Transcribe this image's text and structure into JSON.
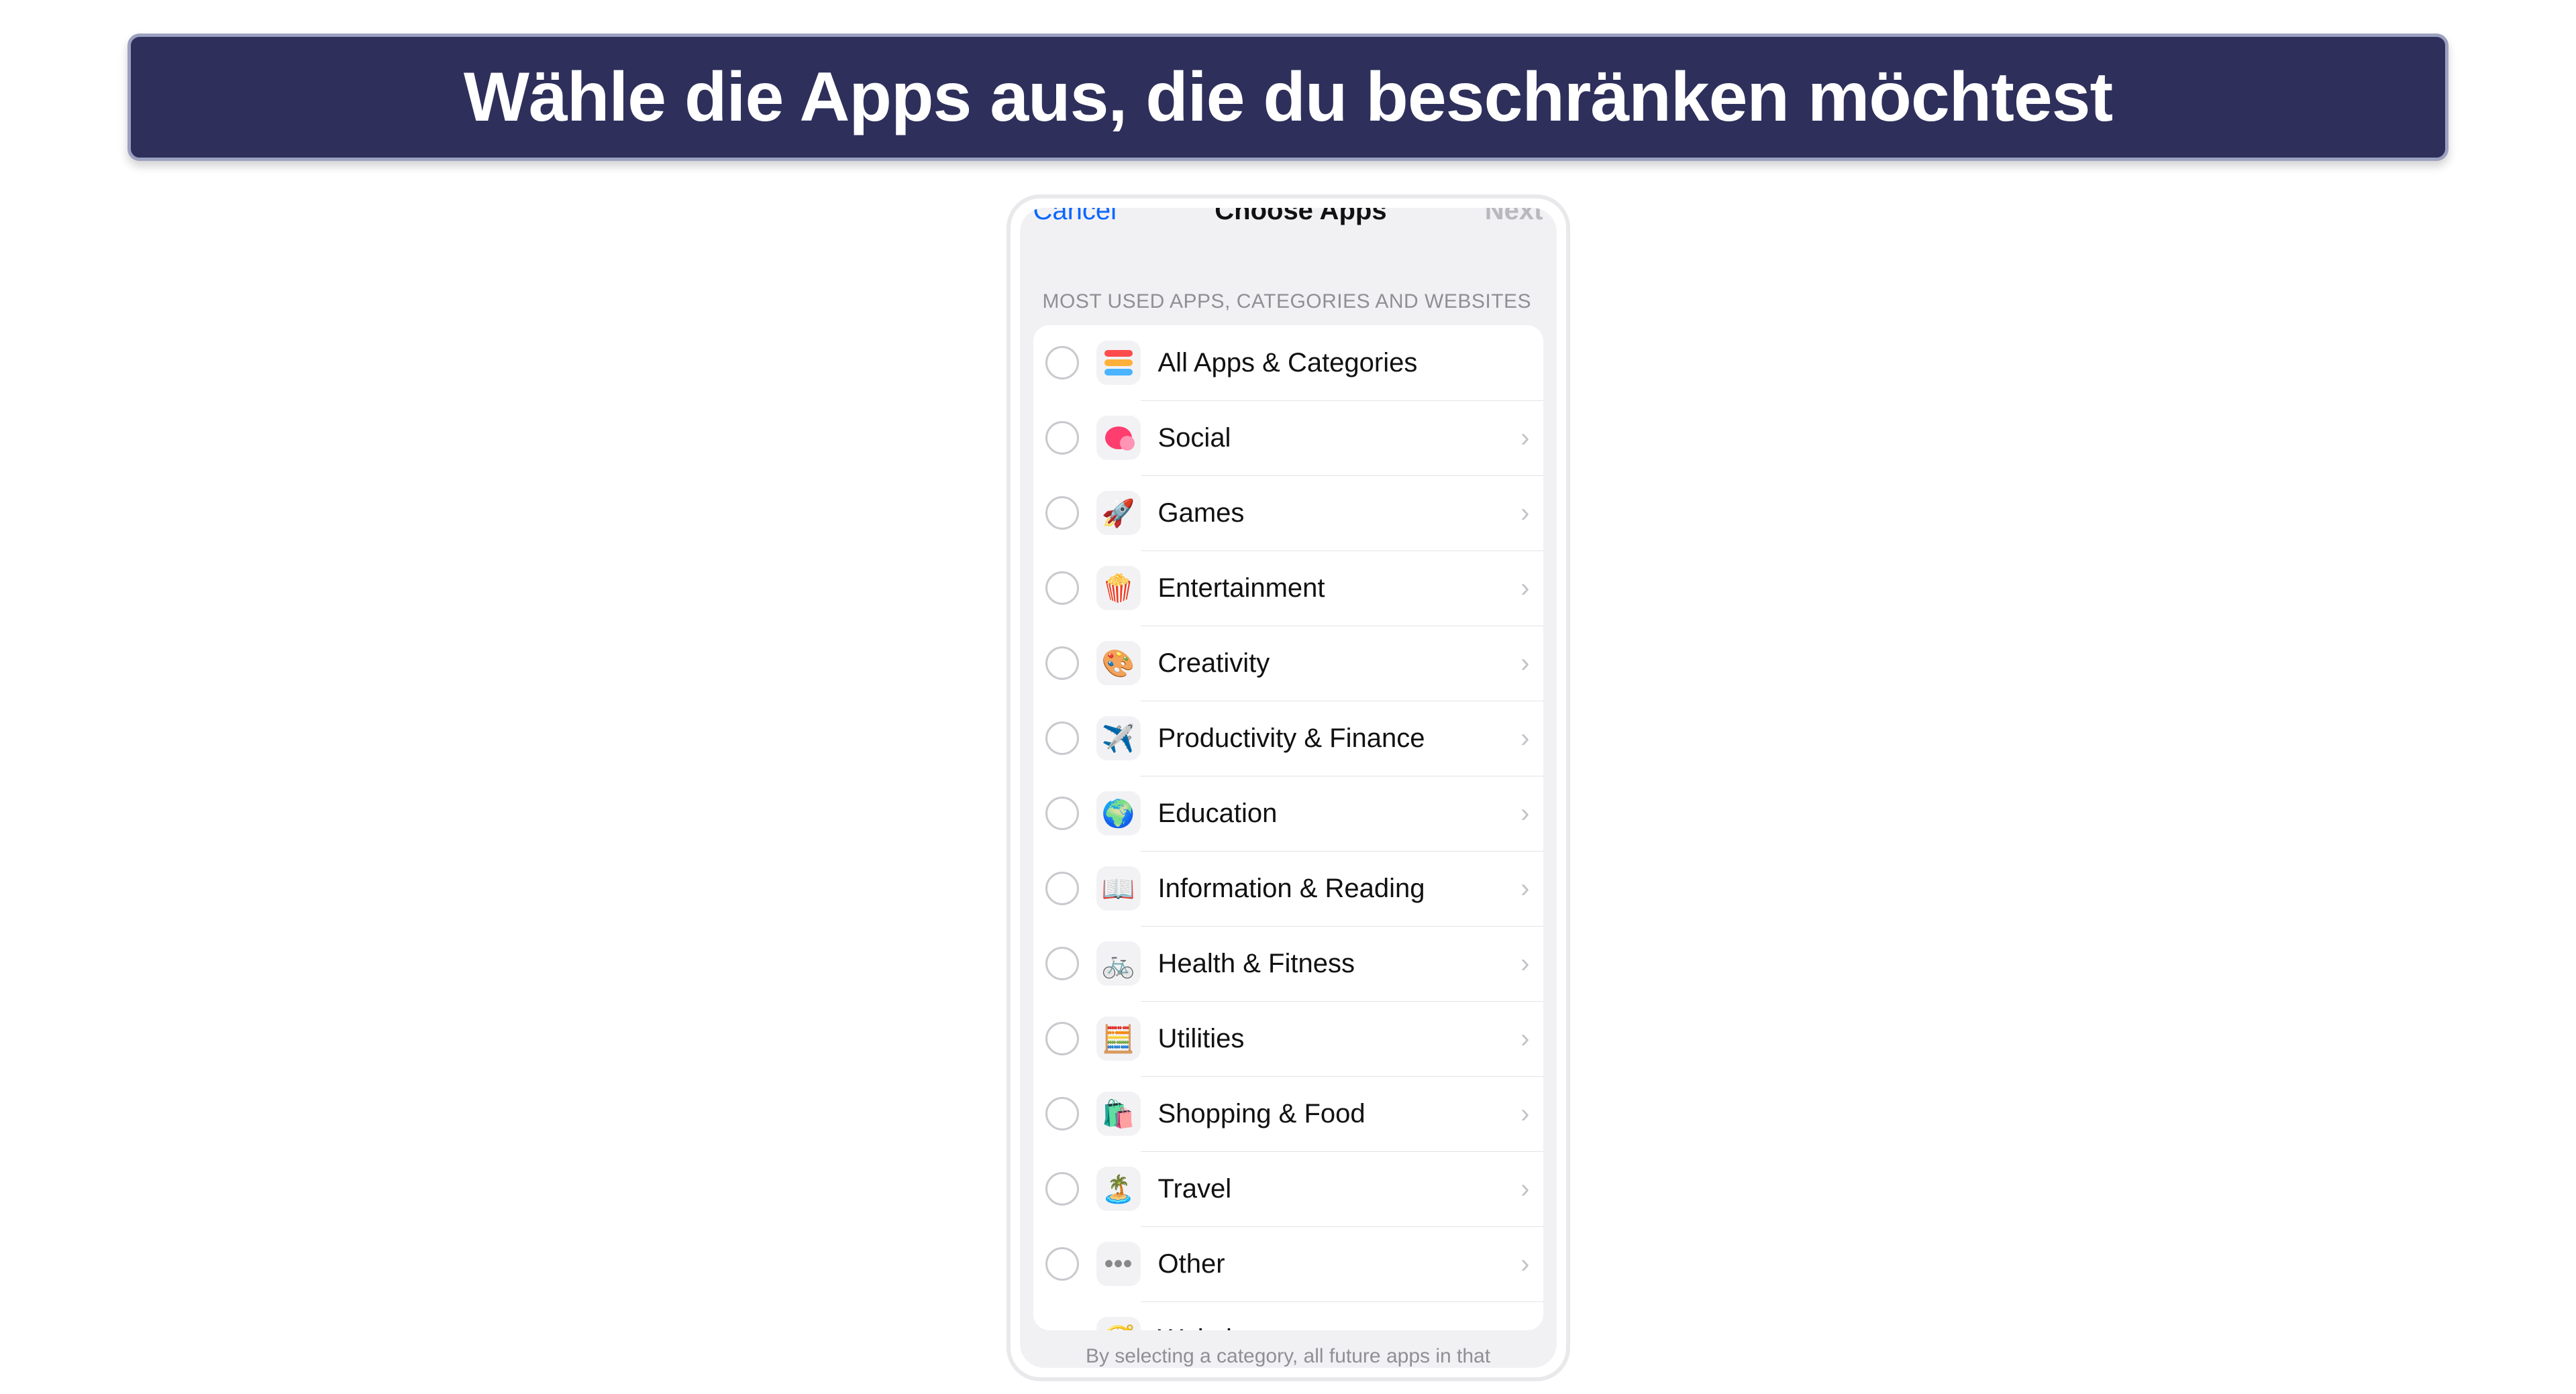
{
  "banner": {
    "text": "Wähle die Apps aus, die du beschränken möchtest"
  },
  "nav": {
    "cancel": "Cancel",
    "title": "Choose Apps",
    "next": "Next"
  },
  "section_header": "MOST USED APPS, CATEGORIES AND WEBSITES",
  "rows": {
    "all": {
      "label": "All Apps & Categories",
      "icon": "stack-icon",
      "has_checkbox": true,
      "has_chevron": false
    },
    "social": {
      "label": "Social",
      "icon": "speech-icon",
      "has_checkbox": true,
      "has_chevron": true
    },
    "games": {
      "label": "Games",
      "icon": "rocket-icon",
      "has_checkbox": true,
      "has_chevron": true
    },
    "entertain": {
      "label": "Entertainment",
      "icon": "popcorn-icon",
      "has_checkbox": true,
      "has_chevron": true
    },
    "creativity": {
      "label": "Creativity",
      "icon": "palette-icon",
      "has_checkbox": true,
      "has_chevron": true
    },
    "productivity": {
      "label": "Productivity & Finance",
      "icon": "paperplane-icon",
      "has_checkbox": true,
      "has_chevron": true
    },
    "education": {
      "label": "Education",
      "icon": "globe-icon",
      "has_checkbox": true,
      "has_chevron": true
    },
    "info": {
      "label": "Information & Reading",
      "icon": "book-icon",
      "has_checkbox": true,
      "has_chevron": true
    },
    "health": {
      "label": "Health & Fitness",
      "icon": "bike-icon",
      "has_checkbox": true,
      "has_chevron": true
    },
    "utilities": {
      "label": "Utilities",
      "icon": "calculator-icon",
      "has_checkbox": true,
      "has_chevron": true
    },
    "shopping": {
      "label": "Shopping & Food",
      "icon": "bag-icon",
      "has_checkbox": true,
      "has_chevron": true
    },
    "travel": {
      "label": "Travel",
      "icon": "palmtree-icon",
      "has_checkbox": true,
      "has_chevron": true
    },
    "other": {
      "label": "Other",
      "icon": "dots-icon",
      "has_checkbox": true,
      "has_chevron": true
    },
    "websites": {
      "label": "Websites",
      "icon": "compass-icon",
      "has_checkbox": false,
      "has_chevron": true
    }
  },
  "footer": "By selecting a category, all future apps in that"
}
